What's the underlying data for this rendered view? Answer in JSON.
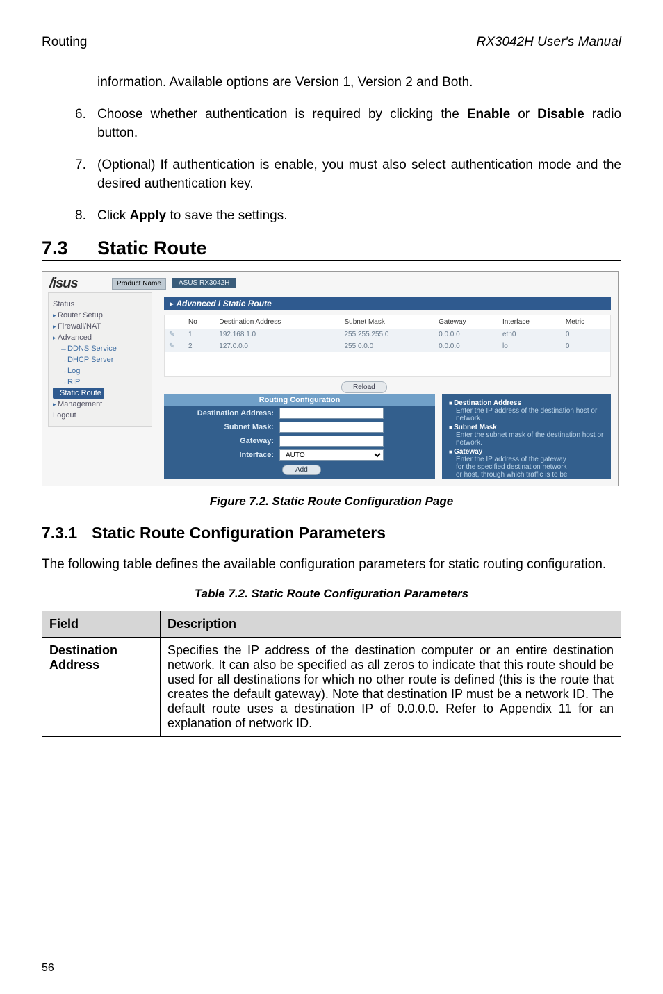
{
  "header": {
    "left": "Routing",
    "right": "RX3042H User's Manual"
  },
  "intro_tail": "information. Available options are Version 1, Version 2 and Both.",
  "list": {
    "i6": {
      "n": "6.",
      "t1": "Choose whether authentication is required by clicking the ",
      "enable": "Enable",
      "or": " or ",
      "disable": "Disable",
      "t2": " radio button."
    },
    "i7": {
      "n": "7.",
      "t": "(Optional) If authentication is enable, you must also select authentication mode and the desired authentication key."
    },
    "i8": {
      "n": "8.",
      "t1": " Click ",
      "apply": "Apply",
      "t2": " to save the settings."
    }
  },
  "sec73": {
    "num": "7.3",
    "title": "Static Route"
  },
  "fig72": "Figure 7.2.  Static Route Configuration Page",
  "sec731": {
    "num": "7.3.1",
    "title": "Static Route Configuration Parameters"
  },
  "para731": "The following table defines the available configuration parameters for static routing configuration.",
  "tbl72cap": "Table 7.2. Static Route Configuration Parameters",
  "tbl72": {
    "h_field": "Field",
    "h_desc": "Description",
    "r1_field": "Destination Address",
    "r1_desc": "Specifies the IP address of the destination computer or an entire destination network. It can also be specified as all zeros to indicate that this route should be used for all destinations for which no other route is defined (this is the route that creates the default gateway). Note that destination IP must be a network ID. The default route uses a destination IP of 0.0.0.0. Refer to Appendix 11 for an explanation of network ID."
  },
  "page_num": "56",
  "screenshot": {
    "logo": "/isus",
    "prodname_label": "Product Name",
    "prodname_value": "ASUS RX3042H",
    "titlebar_prefix": "▸ ",
    "titlebar_a": "Advanced",
    "titlebar_sep": " / ",
    "titlebar_b": "Static Route",
    "sidebar": {
      "status": "Status",
      "router": "Router Setup",
      "firewall": "Firewall/NAT",
      "advanced": "Advanced",
      "ddns": "→DDNS Service",
      "dhcp": "→DHCP Server",
      "log": "→Log",
      "rip": "→RIP",
      "static": "Static Route",
      "mgmt": "Management",
      "logout": "Logout"
    },
    "table": {
      "h_no": "No",
      "h_dest": "Destination Address",
      "h_mask": "Subnet Mask",
      "h_gw": "Gateway",
      "h_if": "Interface",
      "h_metric": "Metric",
      "rows": [
        {
          "no": "1",
          "dest": "192.168.1.0",
          "mask": "255.255.255.0",
          "gw": "0.0.0.0",
          "if": "eth0",
          "metric": "0"
        },
        {
          "no": "2",
          "dest": "127.0.0.0",
          "mask": "255.0.0.0",
          "gw": "0.0.0.0",
          "if": "lo",
          "metric": "0"
        }
      ]
    },
    "reload": "Reload",
    "cfg": {
      "header": "Routing Configuration",
      "dest": "Destination Address:",
      "mask": "Subnet Mask:",
      "gw": "Gateway:",
      "if": "Interface:",
      "if_val": "AUTO",
      "add": "Add"
    },
    "help": {
      "h1": "Destination Address",
      "d1": "Enter the IP address of the destination host or network.",
      "h2": "Subnet Mask",
      "d2": "Enter the subnet mask of the destination host or network.",
      "h3": "Gateway",
      "d3a": "Enter the IP address of the gateway",
      "d3b": "for the specified destination network",
      "d3c": "or host, through which traffic is to be"
    }
  }
}
